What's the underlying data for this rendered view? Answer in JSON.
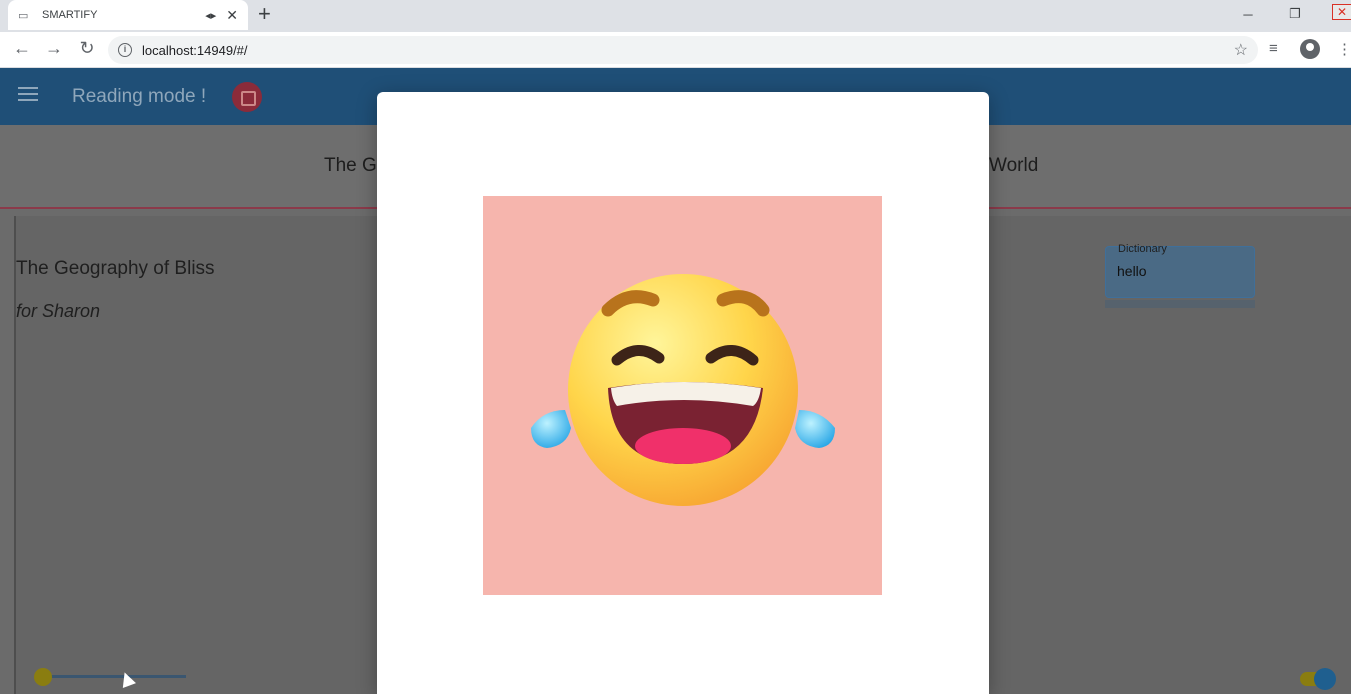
{
  "browser": {
    "tab_title": "SMARTIFY",
    "new_tab_label": "+",
    "url": "localhost:14949/#/",
    "window_controls": {
      "minimize": "─",
      "restore": "❐",
      "close": "✕"
    },
    "icons": [
      "back-icon",
      "forward-icon",
      "reload-icon",
      "info-icon",
      "star-icon",
      "media-icon",
      "profile-icon",
      "menu-dots-icon",
      "audio-icon"
    ]
  },
  "appbar": {
    "title": "Reading mode !",
    "color": "#1f4f77"
  },
  "heading": {
    "left_text": "The G",
    "right_text": "World"
  },
  "poem": {
    "title": "The Geography of Bliss",
    "dedication": "for Sharon"
  },
  "dictionary": {
    "label": "Dictionary",
    "value": "hello"
  },
  "modal": {
    "image_name": "laughing-tears-emoji",
    "image_bg": "#f6b5ad"
  }
}
